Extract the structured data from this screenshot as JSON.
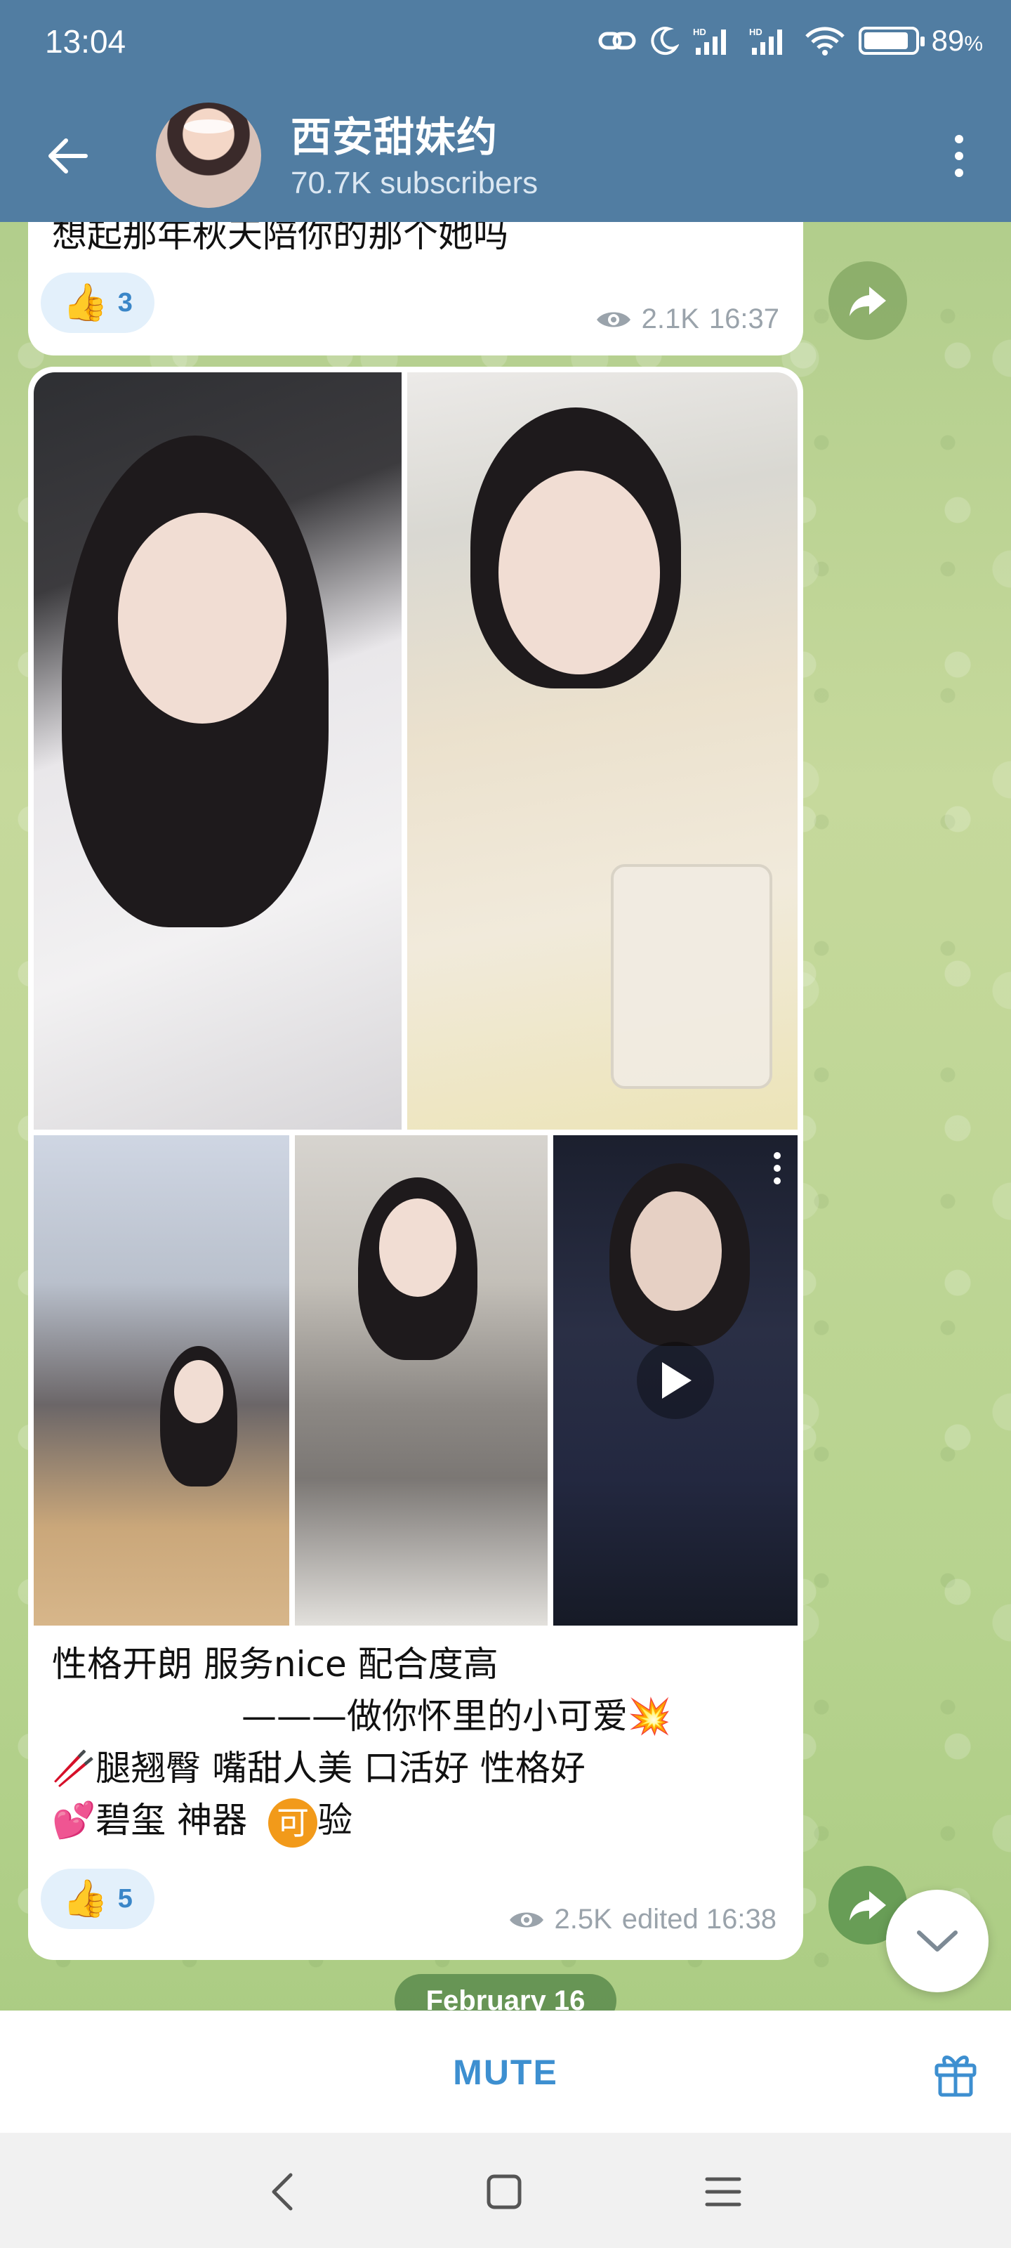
{
  "status_bar": {
    "time": "13:04",
    "battery": "89",
    "battery_unit": "%"
  },
  "header": {
    "title": "西安甜妹约",
    "subscribers": "70.7K subscribers",
    "back_icon": "arrow-left-icon",
    "menu_icon": "more-vertical-icon"
  },
  "messages": [
    {
      "text_partial": "想起那年秋天陪你的那个她吗",
      "reaction": {
        "emoji": "👍",
        "count": "3"
      },
      "views": "2.1K",
      "time": "16:37"
    },
    {
      "caption": {
        "line1": "性格开朗 服务nice   配合度高",
        "line2": "———做你怀里的小可爱💥",
        "line3": "🥢腿翘臀 嘴甜人美 口活好 性格好",
        "line4_text": "💕碧玺  神器",
        "line4_badge": "可",
        "line4_suffix": "验"
      },
      "reaction": {
        "emoji": "👍",
        "count": "5"
      },
      "views": "2.5K",
      "time": "edited 16:38"
    }
  ],
  "date_separator": "February 16",
  "bottom_bar": {
    "mute_label": "MUTE"
  },
  "colors": {
    "header": "#517da2",
    "accent": "#3d8fd0",
    "reaction_bg": "#e3f0fb",
    "badge_orange": "#f29a1a"
  }
}
